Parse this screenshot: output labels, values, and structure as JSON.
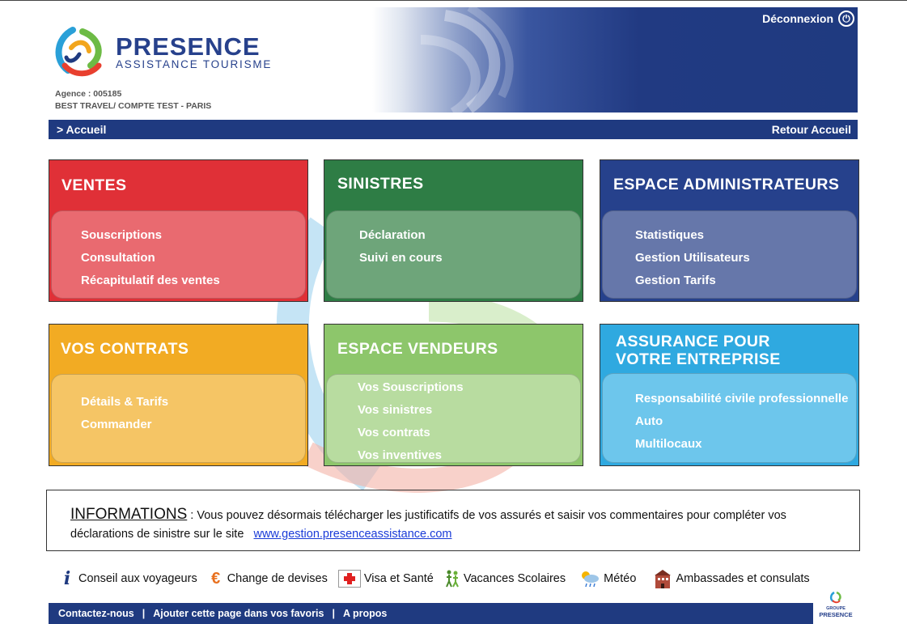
{
  "header": {
    "brand_name": "PRESENCE",
    "brand_sub": "ASSISTANCE TOURISME",
    "agency_label": "Agence :",
    "agency_code": "005185",
    "agency_name": "BEST TRAVEL/ COMPTE TEST - PARIS",
    "logout_label": "Déconnexion"
  },
  "nav": {
    "breadcrumb": "> Accueil",
    "back_label": "Retour Accueil"
  },
  "cards": [
    {
      "title": "VENTES",
      "color": "#e03037",
      "inner_color": "#e96a70",
      "links": [
        "Souscriptions",
        "Consultation",
        "Récapitulatif des ventes"
      ]
    },
    {
      "title": "SINISTRES",
      "color": "#2e7d45",
      "inner_color": "#6ea57a",
      "links": [
        "Déclaration",
        "Suivi en cours"
      ]
    },
    {
      "title": "ESPACE ADMINISTRATEURS",
      "color": "#26418c",
      "inner_color": "#6677aa",
      "links": [
        "Statistiques",
        "Gestion Utilisateurs",
        "Gestion Tarifs"
      ]
    },
    {
      "title": "VOS CONTRATS",
      "color": "#f2ab23",
      "inner_color": "#f5c565",
      "links": [
        "Détails & Tarifs",
        "Commander"
      ]
    },
    {
      "title": "ESPACE VENDEURS",
      "color": "#8dc66b",
      "inner_color": "#b8dca0",
      "links": [
        "Vos Souscriptions",
        "Vos sinistres",
        "Vos contrats",
        "Vos inventives"
      ]
    },
    {
      "title_line1": "ASSURANCE POUR",
      "title_line2": "VOTRE ENTREPRISE",
      "color": "#2fa9e0",
      "inner_color": "#6dc6ec",
      "links": [
        "Responsabilité civile professionnelle",
        "Auto",
        "Multilocaux"
      ]
    }
  ],
  "info": {
    "title": "INFORMATIONS",
    "text1": " : Vous pouvez désormais télécharger les justificatifs de vos assurés et saisir vos commentaires pour compléter vos",
    "text2": "déclarations de sinistre  sur le site",
    "link": "www.gestion.presenceassistance.com"
  },
  "tools": [
    {
      "label": "Conseil aux voyageurs",
      "icon": "info-icon"
    },
    {
      "label": "Change de devises",
      "icon": "euro-icon"
    },
    {
      "label": "Visa et Santé",
      "icon": "red-cross-icon"
    },
    {
      "label": "Vacances Scolaires",
      "icon": "children-icon"
    },
    {
      "label": "Météo",
      "icon": "weather-icon"
    },
    {
      "label": "Ambassades et consulats",
      "icon": "building-icon"
    }
  ],
  "footer": {
    "contact": "Contactez-nous",
    "favorites": "Ajouter cette page dans vos favoris",
    "about": "A propos",
    "sep": "|",
    "group_line1": "GROUPE",
    "group_line2": "PRESENCE"
  }
}
